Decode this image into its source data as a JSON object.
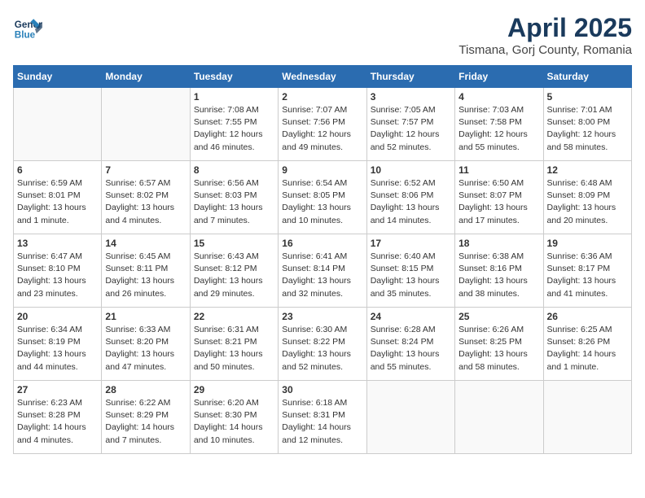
{
  "header": {
    "logo_line1": "General",
    "logo_line2": "Blue",
    "title": "April 2025",
    "subtitle": "Tismana, Gorj County, Romania"
  },
  "weekdays": [
    "Sunday",
    "Monday",
    "Tuesday",
    "Wednesday",
    "Thursday",
    "Friday",
    "Saturday"
  ],
  "weeks": [
    [
      {
        "day": "",
        "info": ""
      },
      {
        "day": "",
        "info": ""
      },
      {
        "day": "1",
        "info": "Sunrise: 7:08 AM\nSunset: 7:55 PM\nDaylight: 12 hours\nand 46 minutes."
      },
      {
        "day": "2",
        "info": "Sunrise: 7:07 AM\nSunset: 7:56 PM\nDaylight: 12 hours\nand 49 minutes."
      },
      {
        "day": "3",
        "info": "Sunrise: 7:05 AM\nSunset: 7:57 PM\nDaylight: 12 hours\nand 52 minutes."
      },
      {
        "day": "4",
        "info": "Sunrise: 7:03 AM\nSunset: 7:58 PM\nDaylight: 12 hours\nand 55 minutes."
      },
      {
        "day": "5",
        "info": "Sunrise: 7:01 AM\nSunset: 8:00 PM\nDaylight: 12 hours\nand 58 minutes."
      }
    ],
    [
      {
        "day": "6",
        "info": "Sunrise: 6:59 AM\nSunset: 8:01 PM\nDaylight: 13 hours\nand 1 minute."
      },
      {
        "day": "7",
        "info": "Sunrise: 6:57 AM\nSunset: 8:02 PM\nDaylight: 13 hours\nand 4 minutes."
      },
      {
        "day": "8",
        "info": "Sunrise: 6:56 AM\nSunset: 8:03 PM\nDaylight: 13 hours\nand 7 minutes."
      },
      {
        "day": "9",
        "info": "Sunrise: 6:54 AM\nSunset: 8:05 PM\nDaylight: 13 hours\nand 10 minutes."
      },
      {
        "day": "10",
        "info": "Sunrise: 6:52 AM\nSunset: 8:06 PM\nDaylight: 13 hours\nand 14 minutes."
      },
      {
        "day": "11",
        "info": "Sunrise: 6:50 AM\nSunset: 8:07 PM\nDaylight: 13 hours\nand 17 minutes."
      },
      {
        "day": "12",
        "info": "Sunrise: 6:48 AM\nSunset: 8:09 PM\nDaylight: 13 hours\nand 20 minutes."
      }
    ],
    [
      {
        "day": "13",
        "info": "Sunrise: 6:47 AM\nSunset: 8:10 PM\nDaylight: 13 hours\nand 23 minutes."
      },
      {
        "day": "14",
        "info": "Sunrise: 6:45 AM\nSunset: 8:11 PM\nDaylight: 13 hours\nand 26 minutes."
      },
      {
        "day": "15",
        "info": "Sunrise: 6:43 AM\nSunset: 8:12 PM\nDaylight: 13 hours\nand 29 minutes."
      },
      {
        "day": "16",
        "info": "Sunrise: 6:41 AM\nSunset: 8:14 PM\nDaylight: 13 hours\nand 32 minutes."
      },
      {
        "day": "17",
        "info": "Sunrise: 6:40 AM\nSunset: 8:15 PM\nDaylight: 13 hours\nand 35 minutes."
      },
      {
        "day": "18",
        "info": "Sunrise: 6:38 AM\nSunset: 8:16 PM\nDaylight: 13 hours\nand 38 minutes."
      },
      {
        "day": "19",
        "info": "Sunrise: 6:36 AM\nSunset: 8:17 PM\nDaylight: 13 hours\nand 41 minutes."
      }
    ],
    [
      {
        "day": "20",
        "info": "Sunrise: 6:34 AM\nSunset: 8:19 PM\nDaylight: 13 hours\nand 44 minutes."
      },
      {
        "day": "21",
        "info": "Sunrise: 6:33 AM\nSunset: 8:20 PM\nDaylight: 13 hours\nand 47 minutes."
      },
      {
        "day": "22",
        "info": "Sunrise: 6:31 AM\nSunset: 8:21 PM\nDaylight: 13 hours\nand 50 minutes."
      },
      {
        "day": "23",
        "info": "Sunrise: 6:30 AM\nSunset: 8:22 PM\nDaylight: 13 hours\nand 52 minutes."
      },
      {
        "day": "24",
        "info": "Sunrise: 6:28 AM\nSunset: 8:24 PM\nDaylight: 13 hours\nand 55 minutes."
      },
      {
        "day": "25",
        "info": "Sunrise: 6:26 AM\nSunset: 8:25 PM\nDaylight: 13 hours\nand 58 minutes."
      },
      {
        "day": "26",
        "info": "Sunrise: 6:25 AM\nSunset: 8:26 PM\nDaylight: 14 hours\nand 1 minute."
      }
    ],
    [
      {
        "day": "27",
        "info": "Sunrise: 6:23 AM\nSunset: 8:28 PM\nDaylight: 14 hours\nand 4 minutes."
      },
      {
        "day": "28",
        "info": "Sunrise: 6:22 AM\nSunset: 8:29 PM\nDaylight: 14 hours\nand 7 minutes."
      },
      {
        "day": "29",
        "info": "Sunrise: 6:20 AM\nSunset: 8:30 PM\nDaylight: 14 hours\nand 10 minutes."
      },
      {
        "day": "30",
        "info": "Sunrise: 6:18 AM\nSunset: 8:31 PM\nDaylight: 14 hours\nand 12 minutes."
      },
      {
        "day": "",
        "info": ""
      },
      {
        "day": "",
        "info": ""
      },
      {
        "day": "",
        "info": ""
      }
    ]
  ]
}
